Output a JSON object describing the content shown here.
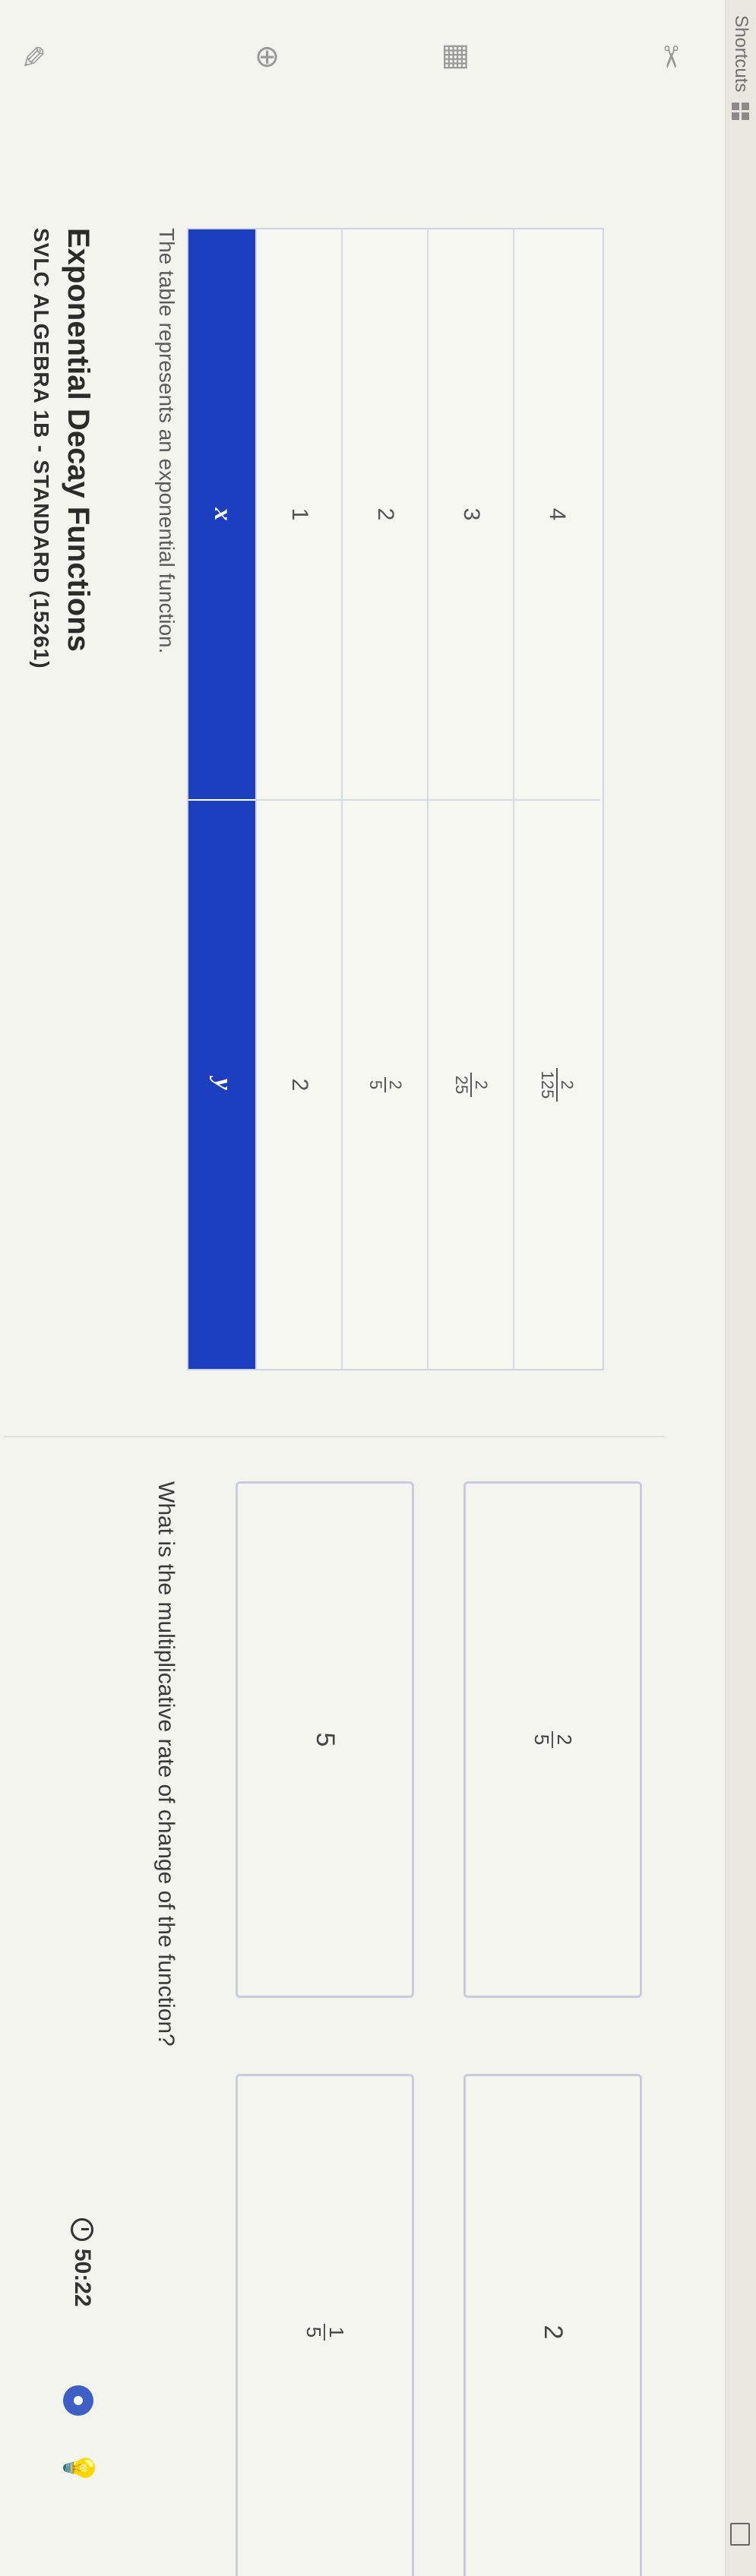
{
  "browser": {
    "shortcuts_label": "Shortcuts"
  },
  "header": {
    "course": "SVLC ALGEBRA 1B - STANDARD (15261)",
    "topic": "Exponential Decay Functions",
    "timer": "50:22"
  },
  "table_section": {
    "prompt": "The table represents an exponential function.",
    "headers": {
      "x": "x",
      "y": "y"
    },
    "rows": [
      {
        "x": "1",
        "y_type": "whole",
        "y": "2"
      },
      {
        "x": "2",
        "y_type": "frac",
        "y_num": "2",
        "y_den": "5"
      },
      {
        "x": "3",
        "y_type": "frac",
        "y_num": "2",
        "y_den": "25"
      },
      {
        "x": "4",
        "y_type": "frac",
        "y_num": "2",
        "y_den": "125"
      }
    ]
  },
  "question": {
    "text": "What is the multiplicative rate of change of the function?",
    "choices": [
      {
        "value": "5"
      },
      {
        "num": "1",
        "den": "5"
      },
      {
        "num": "2",
        "den": "5"
      },
      {
        "value": "2"
      }
    ]
  },
  "colors": {
    "accent": "#1c3fc0",
    "timer_dot": "#3d5fc6"
  }
}
